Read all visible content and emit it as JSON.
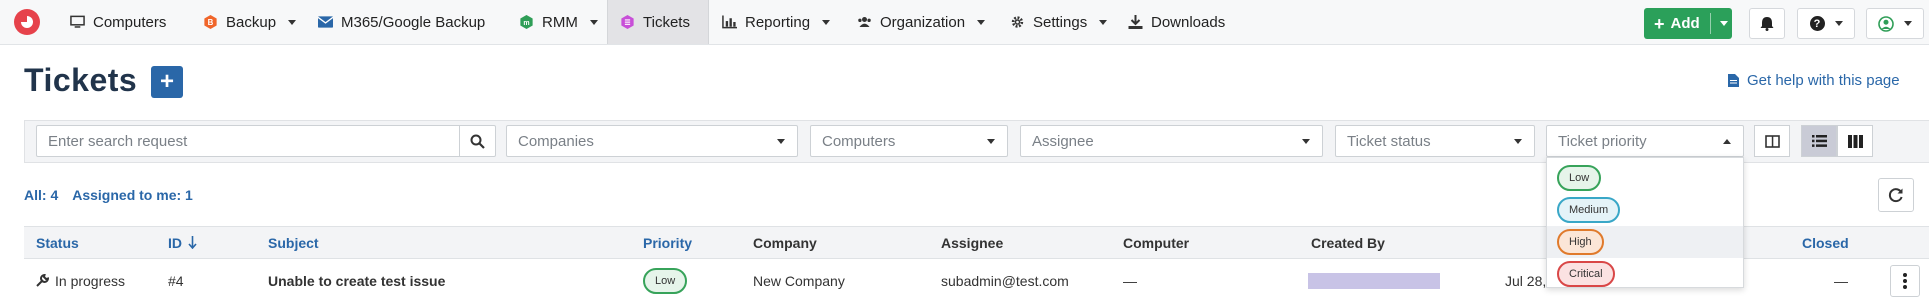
{
  "nav": {
    "items": [
      {
        "label": "Computers",
        "icon": "monitor-icon"
      },
      {
        "label": "Backup",
        "icon": "backup-icon"
      },
      {
        "label": "M365/Google Backup",
        "icon": "envelope-icon"
      },
      {
        "label": "RMM",
        "icon": "rmm-icon"
      },
      {
        "label": "Tickets",
        "icon": "ticket-icon"
      },
      {
        "label": "Reporting",
        "icon": "bar-chart-icon"
      },
      {
        "label": "Organization",
        "icon": "users-icon"
      },
      {
        "label": "Settings",
        "icon": "gear-icon"
      },
      {
        "label": "Downloads",
        "icon": "download-icon"
      }
    ],
    "active": "Tickets",
    "add_label": "Add",
    "add_color": "#2ba05a"
  },
  "page": {
    "title": "Tickets",
    "help_link": "Get help with this page"
  },
  "filters": {
    "search_placeholder": "Enter search request",
    "companies": "Companies",
    "computers": "Computers",
    "assignee": "Assignee",
    "ticket_status": "Ticket status",
    "ticket_priority": "Ticket priority"
  },
  "priority_options": [
    "Low",
    "Medium",
    "High",
    "Critical"
  ],
  "counts": {
    "all": "All: 4",
    "assigned": "Assigned to me: 1"
  },
  "table": {
    "headers": {
      "status": "Status",
      "id": "ID",
      "subject": "Subject",
      "priority": "Priority",
      "company": "Company",
      "assignee": "Assignee",
      "computer": "Computer",
      "created_by": "Created By",
      "closed": "Closed"
    },
    "rows": [
      {
        "status": "In progress",
        "id": "#4",
        "subject": "Unable to create test issue",
        "priority": "Low",
        "company": "New Company",
        "assignee": "subadmin@test.com",
        "computer": "—",
        "created_date": "Jul 28,",
        "closed": "—"
      }
    ]
  },
  "colors": {
    "accent": "#2a67a8",
    "title": "#21344b",
    "tickets_icon": "#c84fd8",
    "backup_icon": "#f0652a",
    "rmm_icon": "#2f9e57"
  }
}
